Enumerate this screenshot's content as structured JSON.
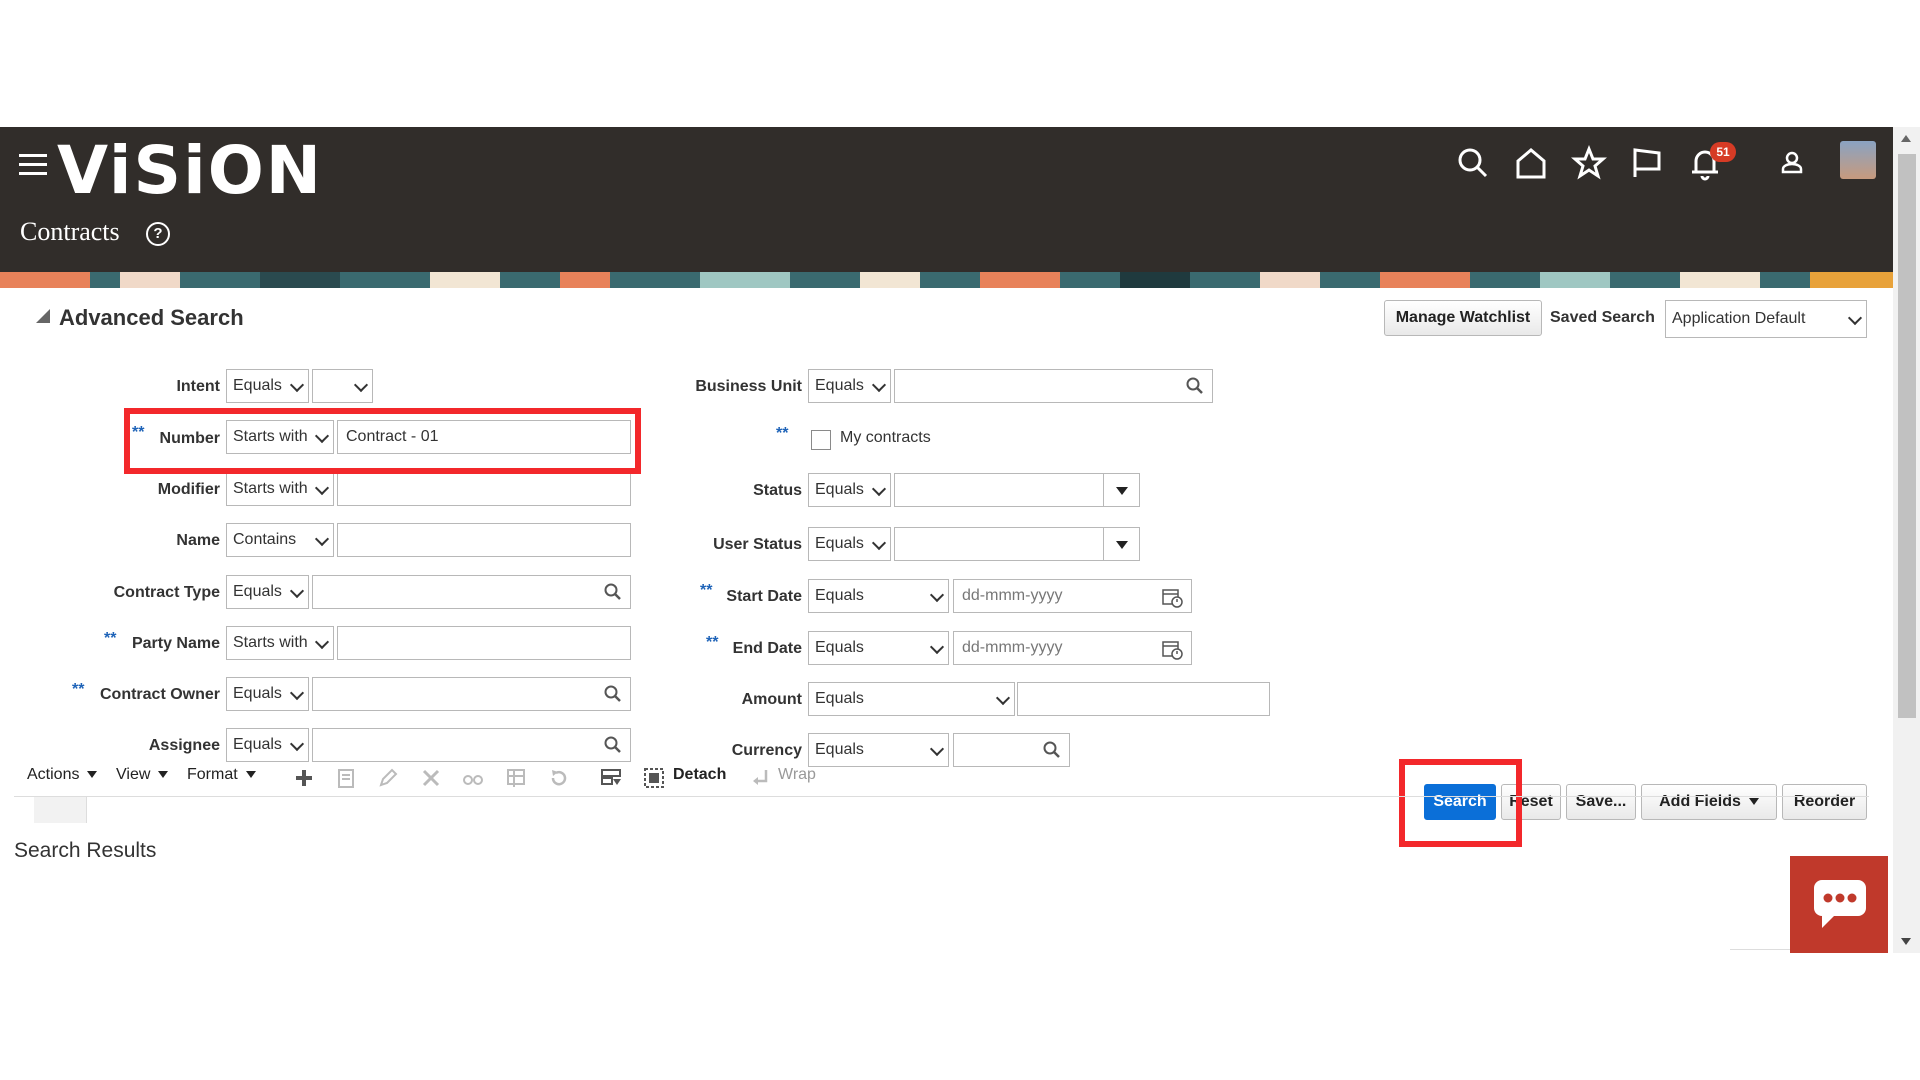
{
  "app": {
    "logo": "ViSiON",
    "page_title": "Contracts",
    "notification_count": "51",
    "colors": {
      "header_bg": "#312d2a",
      "primary": "#0b6fd8",
      "highlight": "#f3282b",
      "required": "#1e63b8"
    }
  },
  "icons": {
    "menu": "hamburger-icon",
    "search": "search-icon",
    "home": "home-icon",
    "favorites": "star-icon",
    "flag": "flag-icon",
    "notifications": "bell-icon",
    "user": "user-icon",
    "help": "help-icon"
  },
  "search": {
    "title": "Advanced Search",
    "manage_watchlist": "Manage Watchlist",
    "saved_search_label": "Saved Search",
    "saved_search_value": "Application Default",
    "required_marker": "**",
    "left": {
      "intent": {
        "label": "Intent",
        "op": "Equals",
        "value": ""
      },
      "number": {
        "label": "Number",
        "op": "Starts with",
        "value": "Contract - 01"
      },
      "modifier": {
        "label": "Modifier",
        "op": "Starts with",
        "value": ""
      },
      "name": {
        "label": "Name",
        "op": "Contains",
        "value": ""
      },
      "contract_type": {
        "label": "Contract Type",
        "op": "Equals",
        "value": ""
      },
      "party_name": {
        "label": "Party Name",
        "op": "Starts with",
        "value": ""
      },
      "contract_owner": {
        "label": "Contract Owner",
        "op": "Equals",
        "value": ""
      },
      "assignee": {
        "label": "Assignee",
        "op": "Equals",
        "value": ""
      }
    },
    "right": {
      "business_unit": {
        "label": "Business Unit",
        "op": "Equals",
        "value": ""
      },
      "my_contracts": {
        "label": "My contracts",
        "checked": false
      },
      "status": {
        "label": "Status",
        "op": "Equals",
        "value": ""
      },
      "user_status": {
        "label": "User Status",
        "op": "Equals",
        "value": ""
      },
      "start_date": {
        "label": "Start Date",
        "op": "Equals",
        "placeholder": "dd-mmm-yyyy"
      },
      "end_date": {
        "label": "End Date",
        "op": "Equals",
        "placeholder": "dd-mmm-yyyy"
      },
      "amount": {
        "label": "Amount",
        "op": "Equals",
        "value": ""
      },
      "currency": {
        "label": "Currency",
        "op": "Equals",
        "value": ""
      }
    },
    "buttons": {
      "search": "Search",
      "reset": "Reset",
      "save": "Save...",
      "add_fields": "Add Fields",
      "reorder": "Reorder"
    }
  },
  "results": {
    "title": "Search Results",
    "toolbar": {
      "actions": "Actions",
      "view": "View",
      "format": "Format",
      "detach": "Detach",
      "wrap": "Wrap"
    }
  }
}
